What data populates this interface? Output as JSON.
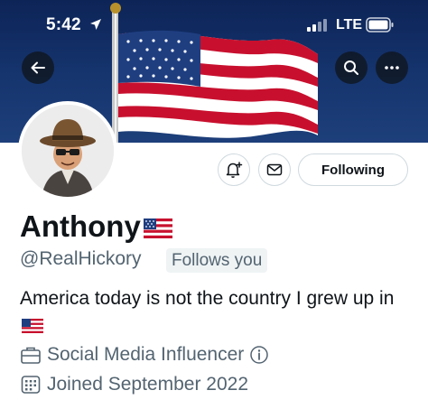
{
  "status_bar": {
    "time": "5:42",
    "network": "LTE"
  },
  "header": {
    "back_icon": "arrow-left-icon",
    "search_icon": "search-icon",
    "more_icon": "more-dots-icon"
  },
  "actions": {
    "notify_icon": "bell-plus-icon",
    "message_icon": "mail-icon",
    "following_label": "Following"
  },
  "profile": {
    "name": "Anthony",
    "handle": "@RealHickory",
    "follows_you": "Follows you",
    "bio": "America today is not the country I grew up in",
    "category": "Social Media Influencer",
    "joined": "Joined September 2022"
  },
  "colors": {
    "banner": "#16356f",
    "secondary_text": "#536471",
    "border": "#cfd9de",
    "badge_bg": "#eff3f4"
  }
}
